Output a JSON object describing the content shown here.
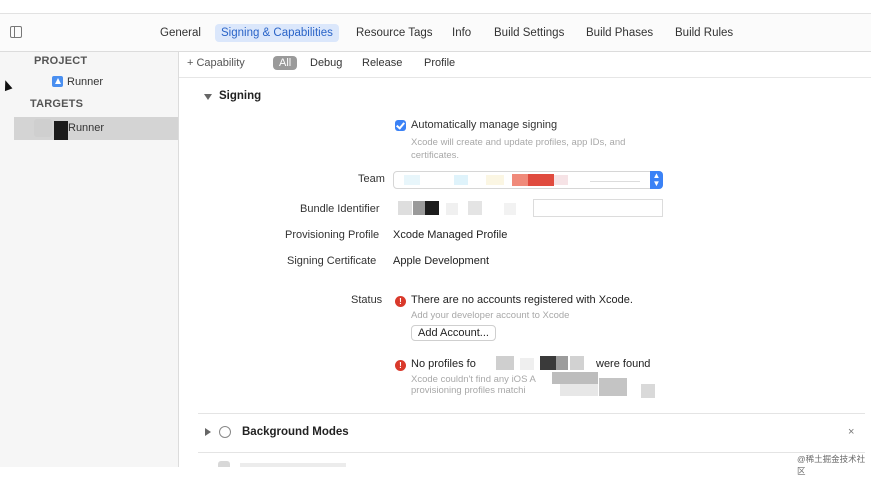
{
  "tabs": [
    {
      "label": "General",
      "active": false
    },
    {
      "label": "Signing & Capabilities",
      "active": true
    },
    {
      "label": "Resource Tags",
      "active": false
    },
    {
      "label": "Info",
      "active": false
    },
    {
      "label": "Build Settings",
      "active": false
    },
    {
      "label": "Build Phases",
      "active": false
    },
    {
      "label": "Build Rules",
      "active": false
    }
  ],
  "sidebar": {
    "project_header": "PROJECT",
    "project_item": "Runner",
    "targets_header": "TARGETS",
    "target_item": "Runner"
  },
  "capability_bar": {
    "add_capability": "+ Capability",
    "filters": [
      "All",
      "Debug",
      "Release",
      "Profile"
    ],
    "selected_filter": "All"
  },
  "signing": {
    "title": "Signing",
    "auto_manage_label": "Automatically manage signing",
    "auto_manage_checked": true,
    "auto_manage_hint_line1": "Xcode will create and update profiles, app IDs, and",
    "auto_manage_hint_line2": "certificates.",
    "team_label": "Team",
    "bundle_id_label": "Bundle Identifier",
    "provisioning_label": "Provisioning Profile",
    "provisioning_value": "Xcode Managed Profile",
    "certificate_label": "Signing Certificate",
    "certificate_value": "Apple Development",
    "status_label": "Status",
    "status_error_1": "There are no accounts registered with Xcode.",
    "status_error_1_hint": "Add your developer account to Xcode",
    "add_account_button": "Add Account...",
    "status_error_2_prefix": "No profiles fo",
    "status_error_2_suffix": "were found",
    "status_error_2_hint_line1": "Xcode couldn't find any iOS A",
    "status_error_2_hint_line2": "provisioning profiles matchi"
  },
  "background_modes": {
    "title": "Background Modes",
    "close_icon": "×"
  },
  "watermark": "@稀土掘金技术社区",
  "colors": {
    "accent": "#3b82f6",
    "active_tab_bg": "#dbe7fb",
    "active_tab_text": "#2a64c8",
    "error": "#d9392b"
  }
}
